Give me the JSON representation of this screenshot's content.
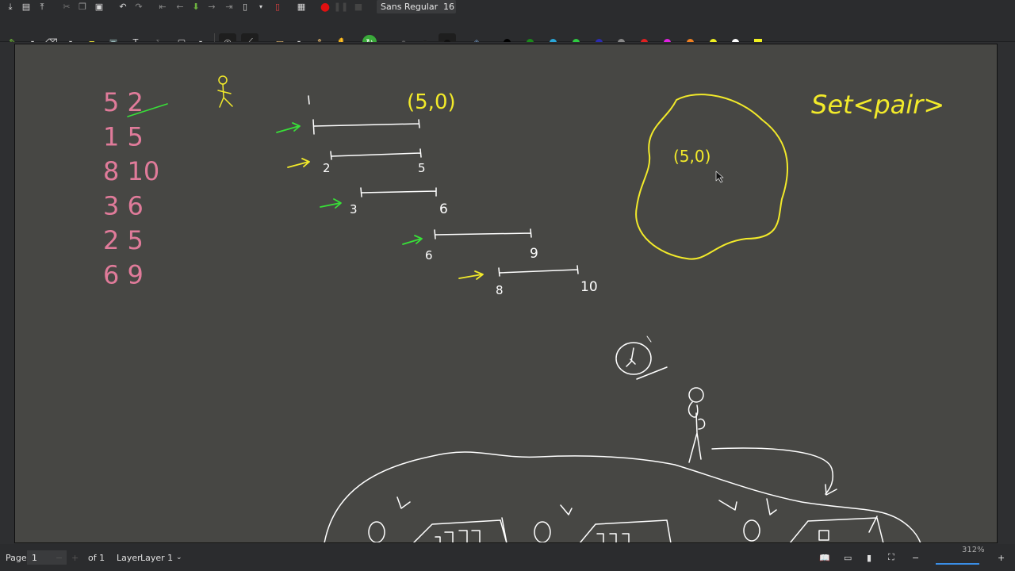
{
  "toolbar": {
    "font_name": "Sans Regular",
    "font_size": "16",
    "pen_colors": [
      "#000000",
      "#1a8a1a",
      "#2aa7d8",
      "#2ecc40",
      "#2b2bb0",
      "#888888",
      "#e02020",
      "#e020e0",
      "#f08020",
      "#f0f020",
      "#ffffff",
      "#f0f020"
    ]
  },
  "statusbar": {
    "page_label": "Page",
    "page_value": "1",
    "of_label": "of 1",
    "layer_label": "Layer",
    "layer_value": "Layer 1",
    "zoom": "312%"
  },
  "drawing": {
    "pairs": [
      "5 2",
      "1 5",
      "8 10",
      "3 6",
      "2 5",
      "6 9"
    ],
    "colors": {
      "pink": "#e07b9a",
      "white": "#ffffff",
      "yellow": "#f2ea2a",
      "green": "#38e038"
    }
  }
}
